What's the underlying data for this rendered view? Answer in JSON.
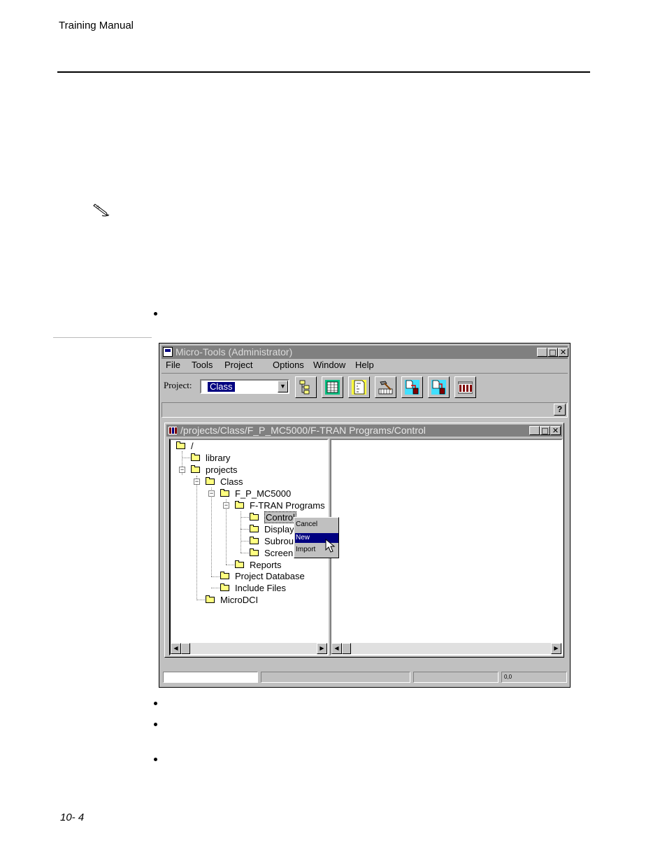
{
  "page": {
    "header": "Training Manual",
    "footer": "10- 4"
  },
  "window": {
    "title": "Micro-Tools (Administrator)",
    "controls": {
      "minimize": "_",
      "maximize": "□",
      "close": "✕"
    },
    "menu": [
      "File",
      "Tools",
      "Project",
      "Options",
      "Window",
      "Help"
    ],
    "project_label": "Project:",
    "project_value": "Class",
    "toolbar_icons": [
      "hierarchy-icon",
      "spreadsheet-icon",
      "flowchart-icon",
      "build-hammer-icon",
      "export-icon",
      "import-icon",
      "database-grid-icon"
    ],
    "help_label": "?",
    "status_coords": "0,0"
  },
  "child_window": {
    "title": "/projects/Class/F_P_MC5000/F-TRAN Programs/Control",
    "tree": {
      "root": "/",
      "library": "library",
      "projects": "projects",
      "class": "Class",
      "fp": "F_P_MC5000",
      "ftran": "F-TRAN Programs",
      "control": "Control",
      "display": "Display",
      "subroutines": "Subrou",
      "screens": "Screen",
      "reports": "Reports",
      "projectdb": "Project Database",
      "include": "Include Files",
      "microdci": "MicroDCI"
    }
  },
  "context_menu": {
    "items": [
      "Cancel",
      "New",
      "Import"
    ],
    "selected": "New"
  }
}
